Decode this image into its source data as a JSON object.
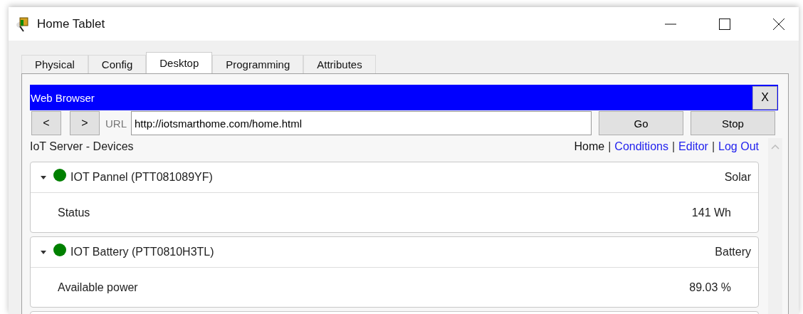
{
  "window": {
    "title": "Home Tablet"
  },
  "tabs": [
    {
      "label": "Physical",
      "selected": false
    },
    {
      "label": "Config",
      "selected": false
    },
    {
      "label": "Desktop",
      "selected": true
    },
    {
      "label": "Programming",
      "selected": false
    },
    {
      "label": "Attributes",
      "selected": false
    }
  ],
  "browser": {
    "title": "Web Browser",
    "close": "X",
    "back": "<",
    "forward": ">",
    "url_label": "URL",
    "url": "http://iotsmarthome.com/home.html",
    "go": "Go",
    "stop": "Stop"
  },
  "page": {
    "heading": "IoT Server - Devices",
    "separator": "|",
    "nav": [
      {
        "label": "Home",
        "selected": true
      },
      {
        "label": "Conditions",
        "selected": false
      },
      {
        "label": "Editor",
        "selected": false
      },
      {
        "label": "Log Out",
        "selected": false
      }
    ],
    "devices": [
      {
        "name": "IOT Pannel (PTT081089YF)",
        "type": "Solar",
        "expanded": true,
        "color": "#008000",
        "rows": [
          {
            "label": "Status",
            "value": "141 Wh"
          }
        ]
      },
      {
        "name": "IOT Battery (PTT0810H3TL)",
        "type": "Battery",
        "expanded": true,
        "color": "#008000",
        "rows": [
          {
            "label": "Available power",
            "value": "89.03 %"
          }
        ]
      }
    ]
  }
}
